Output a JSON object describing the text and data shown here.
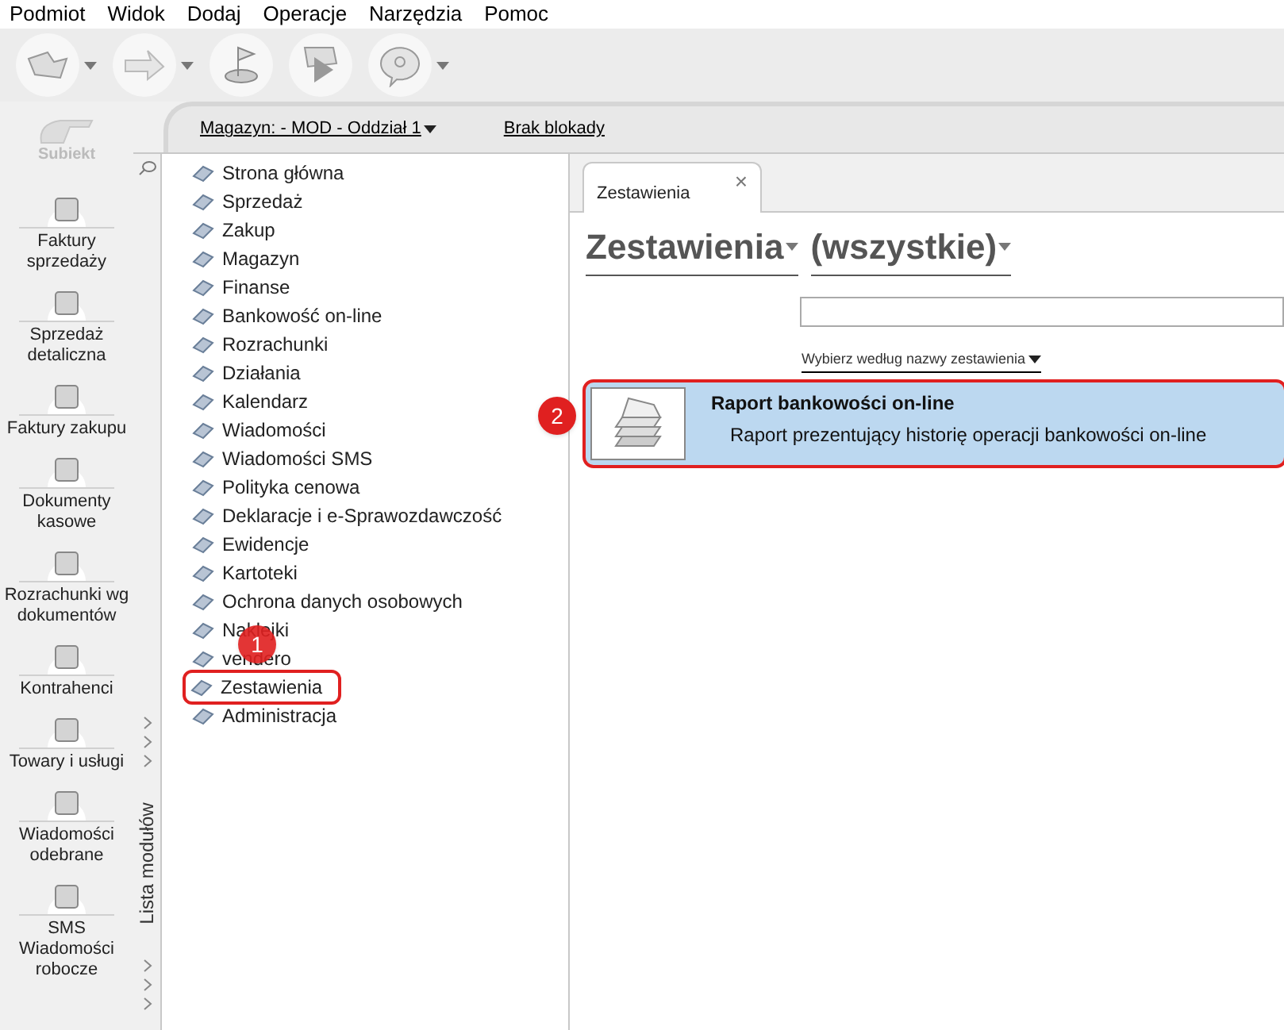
{
  "menu": [
    "Podmiot",
    "Widok",
    "Dodaj",
    "Operacje",
    "Narzędzia",
    "Pomoc"
  ],
  "toolbar": [
    {
      "kind": "arrow-left",
      "dropdown": true
    },
    {
      "kind": "arrow-right",
      "dropdown": true
    },
    {
      "kind": "flag",
      "dropdown": false
    },
    {
      "kind": "play",
      "dropdown": false
    },
    {
      "kind": "help",
      "dropdown": true
    }
  ],
  "logo": {
    "text": "Subiekt"
  },
  "shortcuts": [
    {
      "label": "Faktury sprzedaży"
    },
    {
      "label": "Sprzedaż detaliczna"
    },
    {
      "label": "Faktury zakupu"
    },
    {
      "label": "Dokumenty kasowe"
    },
    {
      "label": "Rozrachunki wg dokumentów"
    },
    {
      "label": "Kontrahenci"
    },
    {
      "label": "Towary i usługi"
    },
    {
      "label": "Wiadomości odebrane"
    },
    {
      "label": "SMS Wiadomości robocze"
    }
  ],
  "header": {
    "warehouse": "Magazyn: - MOD - Oddział 1",
    "lock": "Brak blokady"
  },
  "module_panel": {
    "title": "Lista modułów",
    "items": [
      {
        "label": "Strona główna",
        "highlighted": false
      },
      {
        "label": "Sprzedaż",
        "highlighted": false
      },
      {
        "label": "Zakup",
        "highlighted": false
      },
      {
        "label": "Magazyn",
        "highlighted": false
      },
      {
        "label": "Finanse",
        "highlighted": false
      },
      {
        "label": "Bankowość on-line",
        "highlighted": false
      },
      {
        "label": "Rozrachunki",
        "highlighted": false
      },
      {
        "label": "Działania",
        "highlighted": false
      },
      {
        "label": "Kalendarz",
        "highlighted": false
      },
      {
        "label": "Wiadomości",
        "highlighted": false
      },
      {
        "label": "Wiadomości SMS",
        "highlighted": false
      },
      {
        "label": "Polityka cenowa",
        "highlighted": false
      },
      {
        "label": "Deklaracje i e-Sprawozdawczość",
        "highlighted": false
      },
      {
        "label": "Ewidencje",
        "highlighted": false
      },
      {
        "label": "Kartoteki",
        "highlighted": false
      },
      {
        "label": "Ochrona danych osobowych",
        "highlighted": false
      },
      {
        "label": "Naklejki",
        "highlighted": false
      },
      {
        "label": "vendero",
        "highlighted": false
      },
      {
        "label": "Zestawienia",
        "highlighted": true
      },
      {
        "label": "Administracja",
        "highlighted": false
      }
    ]
  },
  "tabs": [
    {
      "label": "Zestawienia",
      "selected": true,
      "close": "×"
    }
  ],
  "content": {
    "category": "Zestawienia",
    "filter": "(wszystkie)",
    "sort_link": "Wybierz według nazwy zestawienia",
    "reports": [
      {
        "title": "Raport bankowości on-line",
        "description": "Raport prezentujący historię operacji bankowości on-line",
        "selected": true,
        "highlighted": true
      }
    ]
  },
  "annotations": [
    {
      "label": "1"
    },
    {
      "label": "2"
    }
  ]
}
